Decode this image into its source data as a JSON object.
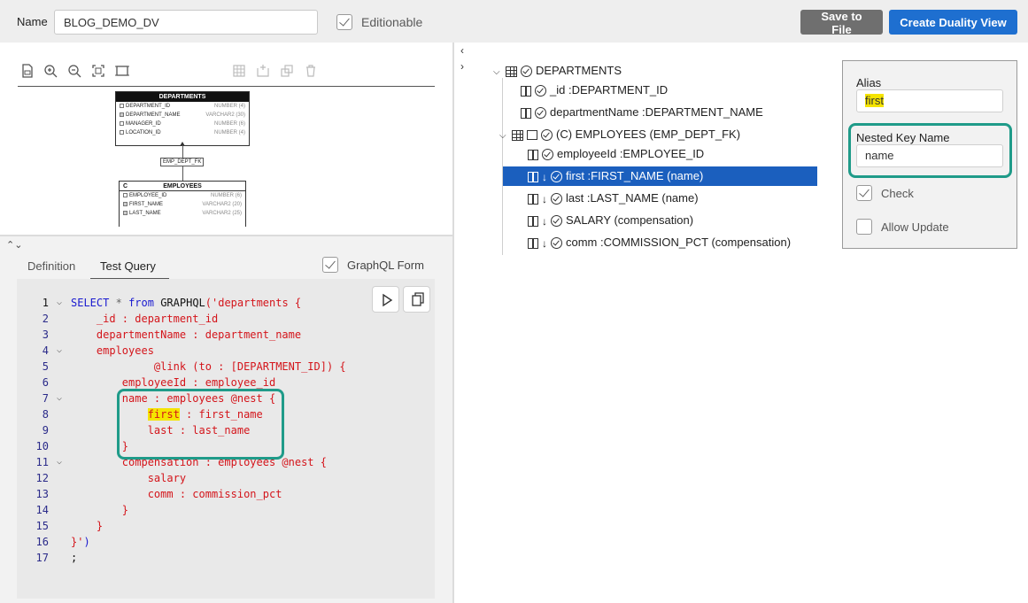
{
  "toolbar": {
    "name_label": "Name",
    "name_value": "BLOG_DEMO_DV",
    "editionable_label": "Editionable",
    "editionable_checked": true,
    "save_label": "Save to File",
    "create_label": "Create Duality View",
    "colors": {
      "save_bg": "#6f6f6f",
      "create_bg": "#1e6fd0"
    }
  },
  "diagram": {
    "departments": {
      "title": "DEPARTMENTS",
      "columns": [
        {
          "name": "DEPARTMENT_ID",
          "type": "NUMBER (4)",
          "checked": false
        },
        {
          "name": "DEPARTMENT_NAME",
          "type": "VARCHAR2 (30)",
          "checked": true
        },
        {
          "name": "MANAGER_ID",
          "type": "NUMBER (6)",
          "checked": false
        },
        {
          "name": "LOCATION_ID",
          "type": "NUMBER (4)",
          "checked": false
        }
      ]
    },
    "fk_label": "EMP_DEPT_FK",
    "employees": {
      "prefix": "C",
      "title": "EMPLOYEES",
      "columns": [
        {
          "name": "EMPLOYEE_ID",
          "type": "NUMBER (6)",
          "checked": false
        },
        {
          "name": "FIRST_NAME",
          "type": "VARCHAR2 (20)",
          "checked": true
        },
        {
          "name": "LAST_NAME",
          "type": "VARCHAR2 (25)",
          "checked": true
        }
      ]
    }
  },
  "query": {
    "tabs": [
      "Definition",
      "Test Query"
    ],
    "active_tab": "Test Query",
    "graphql_form_label": "GraphQL Form",
    "graphql_form_checked": true,
    "lines": [
      {
        "n": "1",
        "fold": true,
        "text": "SELECT * from GRAPHQL('departments {"
      },
      {
        "n": "2",
        "fold": false,
        "text": "    _id : department_id"
      },
      {
        "n": "3",
        "fold": false,
        "text": "    departmentName : department_name"
      },
      {
        "n": "4",
        "fold": true,
        "text": "    employees"
      },
      {
        "n": "5",
        "fold": false,
        "text": "             @link (to : [DEPARTMENT_ID]) {"
      },
      {
        "n": "6",
        "fold": false,
        "text": "        employeeId : employee_id"
      },
      {
        "n": "7",
        "fold": true,
        "text": "        name : employees @nest {"
      },
      {
        "n": "8",
        "fold": false,
        "text": "            first : first_name"
      },
      {
        "n": "9",
        "fold": false,
        "text": "            last : last_name"
      },
      {
        "n": "10",
        "fold": false,
        "text": "        }"
      },
      {
        "n": "11",
        "fold": true,
        "text": "        compensation : employees @nest {"
      },
      {
        "n": "12",
        "fold": false,
        "text": "            salary"
      },
      {
        "n": "13",
        "fold": false,
        "text": "            comm : commission_pct"
      },
      {
        "n": "14",
        "fold": false,
        "text": "        }"
      },
      {
        "n": "15",
        "fold": false,
        "text": "    }"
      },
      {
        "n": "16",
        "fold": false,
        "text": "}')"
      },
      {
        "n": "17",
        "fold": false,
        "text": ";"
      }
    ],
    "highlight_word": "first"
  },
  "tree": {
    "root": "DEPARTMENTS",
    "items": [
      {
        "label": "_id :DEPARTMENT_ID"
      },
      {
        "label": "departmentName :DEPARTMENT_NAME"
      },
      {
        "label": "(C) EMPLOYEES (EMP_DEPT_FK)"
      },
      {
        "label": "employeeId :EMPLOYEE_ID"
      },
      {
        "label": "first :FIRST_NAME (name)"
      },
      {
        "label": "last :LAST_NAME (name)"
      },
      {
        "label": "SALARY (compensation)"
      },
      {
        "label": "comm :COMMISSION_PCT (compensation)"
      }
    ],
    "selected_index": 4
  },
  "props": {
    "alias_label": "Alias",
    "alias_value": "first",
    "nested_label": "Nested Key Name",
    "nested_value": "name",
    "check_label": "Check",
    "check_checked": true,
    "allow_update_label": "Allow Update",
    "allow_update_checked": false
  }
}
